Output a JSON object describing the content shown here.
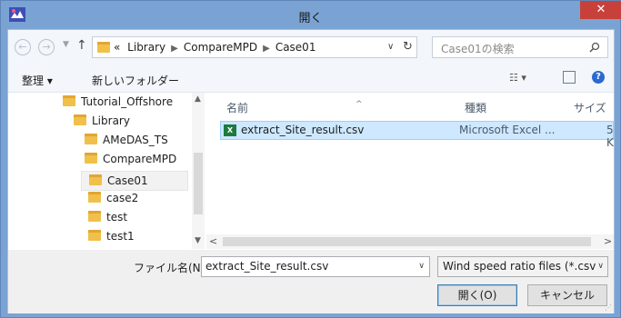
{
  "window": {
    "title": "開く",
    "close_glyph": "✕"
  },
  "nav": {
    "back": "←",
    "forward": "→",
    "up": "↑"
  },
  "address": {
    "crumbs": [
      "«",
      "Library",
      "CompareMPD",
      "Case01"
    ],
    "search_placeholder": "Case01の検索"
  },
  "toolbar": {
    "organize": "整理 ▾",
    "new_folder": "新しいフォルダー"
  },
  "tree": {
    "items": [
      {
        "label": "Tutorial_Offshore"
      },
      {
        "label": "Library"
      },
      {
        "label": "AMeDAS_TS"
      },
      {
        "label": "CompareMPD"
      },
      {
        "label": "Case01"
      },
      {
        "label": "case2"
      },
      {
        "label": "test"
      },
      {
        "label": "test1"
      }
    ]
  },
  "list": {
    "columns": {
      "name": "名前",
      "type": "種類",
      "size": "サイズ"
    },
    "files": [
      {
        "name": "extract_Site_result.csv",
        "type": "Microsoft Excel ...",
        "size": "5 K"
      }
    ]
  },
  "bottom": {
    "filename_label": "ファイル名(N):",
    "filename_value": "extract_Site_result.csv",
    "filter_value": "Wind speed ratio files (*.csv",
    "open_label": "開く(O)",
    "cancel_label": "キャンセル"
  },
  "colors": {
    "title_bar": "#7aa3d3",
    "close": "#c7413a",
    "selection": "#cde8ff"
  }
}
